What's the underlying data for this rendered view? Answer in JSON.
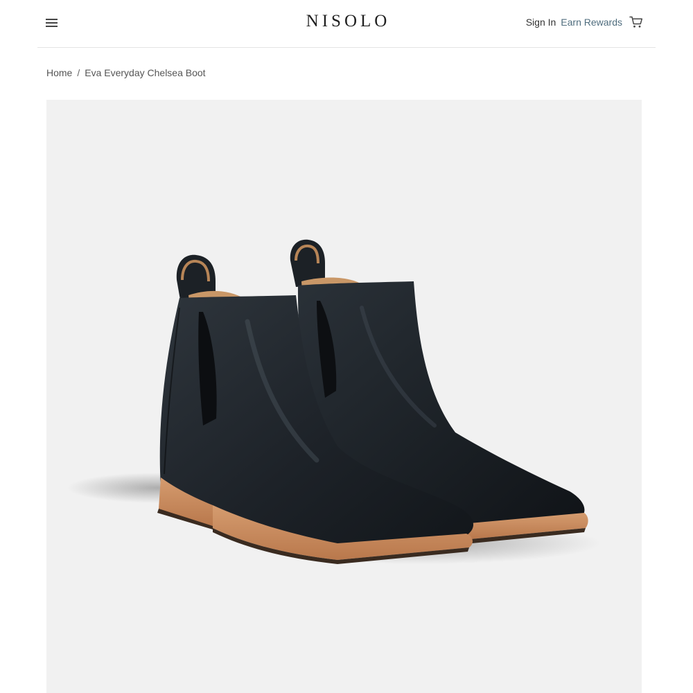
{
  "header": {
    "menu_icon": "hamburger-menu-icon",
    "logo_text": "NISOLO",
    "sign_in_label": "Sign In",
    "rewards_label": "Earn Rewards",
    "cart_icon": "shopping-cart-icon"
  },
  "breadcrumb": {
    "home_label": "Home",
    "separator": "/",
    "current_label": "Eva Everyday Chelsea Boot"
  },
  "product": {
    "image_subject": "pair of black leather chelsea boots with natural leather soles"
  },
  "colors": {
    "rewards_link": "#4f6d7e",
    "image_background": "#f1f1f1",
    "boot_leather": "#1e242a",
    "sole": "#c68a5c"
  }
}
